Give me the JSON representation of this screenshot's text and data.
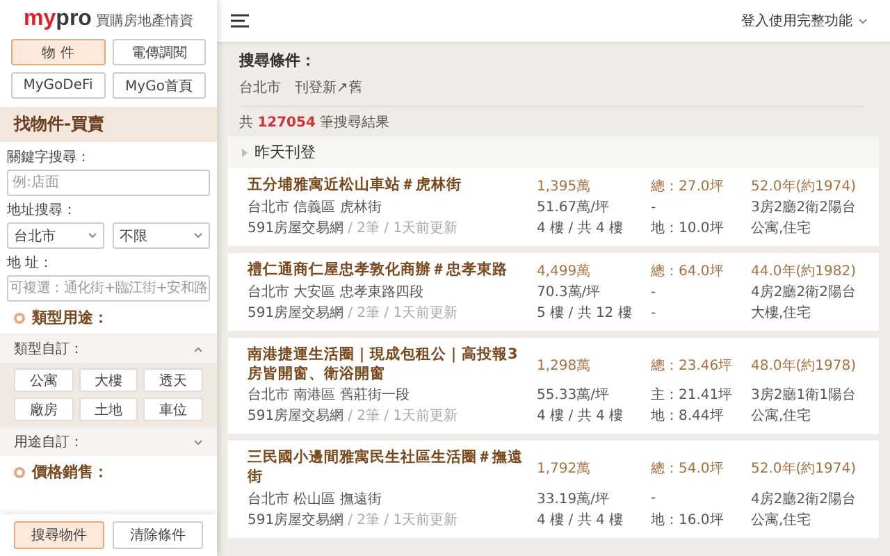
{
  "logo": {
    "parts": [
      {
        "text": "my",
        "color": "#e0202a"
      },
      {
        "text": "pro",
        "color": "#3a3a3a"
      }
    ],
    "tagline": "買購房地產情資"
  },
  "nav_buttons": [
    {
      "label": "物 件",
      "selected": true
    },
    {
      "label": "電傳調閱",
      "selected": false
    },
    {
      "label": "MyGoDeFi",
      "selected": false
    },
    {
      "label": "MyGo首頁",
      "selected": false
    }
  ],
  "sidebar": {
    "section_title": "找物件-買賣",
    "keyword": {
      "label": "關鍵字搜尋：",
      "placeholder": "例:店面"
    },
    "address_search": {
      "label": "地址搜尋：",
      "city": "台北市",
      "district": "不限"
    },
    "address": {
      "label": "地 址：",
      "placeholder": "可複選：通化街+臨江街+安和路"
    },
    "type_heading": "類型用途：",
    "type_custom": {
      "label": "類型自訂：",
      "expanded": true,
      "chips": [
        "公寓",
        "大樓",
        "透天",
        "廠房",
        "土地",
        "車位"
      ]
    },
    "usage_custom": {
      "label": "用途自訂：",
      "expanded": false
    },
    "price_heading": "價格銷售：",
    "footer_buttons": [
      {
        "label": "搜尋物件",
        "kind": "primary"
      },
      {
        "label": "清除條件",
        "kind": "secondary"
      }
    ]
  },
  "header": {
    "login": "登入使用完整功能"
  },
  "criteria": {
    "title": "搜尋條件：",
    "tags": [
      "台北市",
      "刊登新↗舊"
    ],
    "result": "共 **127054** 筆搜尋結果"
  },
  "group": {
    "label": "昨天刊登"
  },
  "listings": [
    {
      "title": "五分埔雅寓近松山車站＃虎林街",
      "price": "1,395萬",
      "total": "總：27.0坪",
      "age": "52.0年(約1974)",
      "address": "台北市 信義區 虎林街",
      "unit_price": "51.67萬/坪",
      "main": "-",
      "layout": "3房2廳2衛2陽台",
      "source": "591房屋交易網",
      "meta": "/ 2筆 / 1天前更新",
      "floor": "4 樓 / 共 4 樓",
      "land": "地：10.0坪",
      "usage": "公寓,住宅"
    },
    {
      "title": "禮仁通商仁屋忠孝敦化商辦＃忠孝東路",
      "price": "4,499萬",
      "total": "總：64.0坪",
      "age": "44.0年(約1982)",
      "address": "台北市 大安區 忠孝東路四段",
      "unit_price": "70.3萬/坪",
      "main": "-",
      "layout": "4房2廳2衛2陽台",
      "source": "591房屋交易網",
      "meta": "/ 2筆 / 1天前更新",
      "floor": "5 樓 / 共 12 樓",
      "land": "-",
      "usage": "大樓,住宅"
    },
    {
      "title": "南港捷運生活圈｜現成包租公｜高投報3房皆開窗、衛浴開窗",
      "price": "1,298萬",
      "total": "總：23.46坪",
      "age": "48.0年(約1978)",
      "address": "台北市 南港區 舊莊街一段",
      "unit_price": "55.33萬/坪",
      "main": "主：21.41坪",
      "layout": "3房2廳1衛1陽台",
      "source": "591房屋交易網",
      "meta": "/ 2筆 / 1天前更新",
      "floor": "4 樓 / 共 4 樓",
      "land": "地：8.44坪",
      "usage": "公寓,住宅"
    },
    {
      "title": "三民國小邊間雅寓民生社區生活圈＃撫遠街",
      "price": "1,792萬",
      "total": "總：54.0坪",
      "age": "52.0年(約1974)",
      "address": "台北市 松山區 撫遠街",
      "unit_price": "33.19萬/坪",
      "main": "-",
      "layout": "4房2廳2衛2陽台",
      "source": "591房屋交易網",
      "meta": "/ 2筆 / 1天前更新",
      "floor": "4 樓 / 共 4 樓",
      "land": "地：16.0坪",
      "usage": "公寓,住宅"
    }
  ]
}
